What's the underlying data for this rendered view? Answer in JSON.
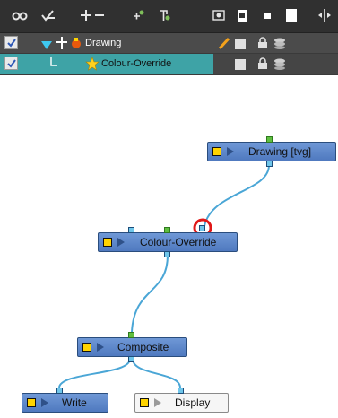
{
  "toolbar": {
    "icons": [
      "show-all-icon",
      "enable-all-icon",
      "add-layer-icon",
      "remove-layer-icon",
      "add-drawing-layer-icon",
      "add-peg-icon",
      "layer-properties-icon",
      "show-thumbnails-icon",
      "small-square-icon",
      "large-square-icon",
      "split-view-icon"
    ]
  },
  "layers": [
    {
      "name": "Drawing",
      "checked": true,
      "icons": [
        "expand-arrow-icon",
        "peg-icon",
        "drawing-layer-icon",
        "pencil-icon",
        "color-swatch-icon",
        "lock-icon",
        "stack-icon"
      ]
    },
    {
      "name": "Colour-Override",
      "checked": true,
      "icons": [
        "child-connector-icon",
        "star-effect-icon",
        "color-swatch-icon",
        "lock-icon",
        "stack-icon"
      ]
    }
  ],
  "nodes": {
    "drawing": {
      "label": "Drawing  [tvg]"
    },
    "colour_override": {
      "label": "Colour-Override"
    },
    "composite": {
      "label": "Composite"
    },
    "write": {
      "label": "Write"
    },
    "display": {
      "label": "Display"
    }
  },
  "colors": {
    "toolbar_bg": "#303030",
    "layer_row_bg": "#4b4b4b",
    "selected_row_bg": "#3ea3a6",
    "node_fill": "#5b84c9",
    "wire": "#4aa6d6",
    "highlight_ring": "#e01818"
  }
}
